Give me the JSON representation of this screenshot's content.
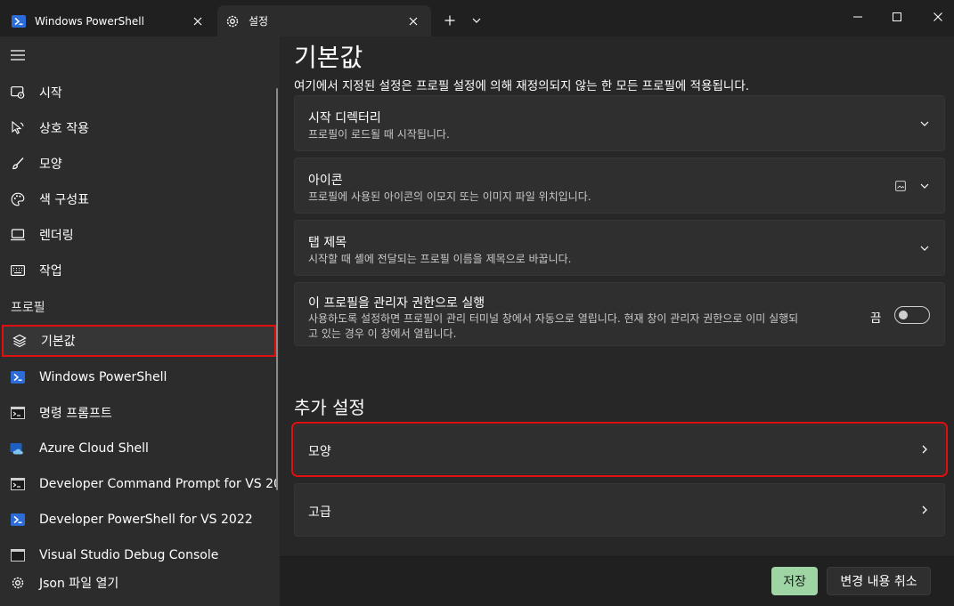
{
  "titlebar": {
    "tabs": [
      {
        "label": "Windows PowerShell",
        "icon": "powershell-icon"
      },
      {
        "label": "설정",
        "icon": "gear-icon"
      }
    ],
    "new_tab_icon": "plus-icon",
    "tab_menu_icon": "chevron-down-icon"
  },
  "sidebar": {
    "items": [
      {
        "label": "시작",
        "icon": "startup-icon"
      },
      {
        "label": "상호 작용",
        "icon": "cursor-icon"
      },
      {
        "label": "모양",
        "icon": "brush-icon"
      },
      {
        "label": "색 구성표",
        "icon": "palette-icon"
      },
      {
        "label": "렌더링",
        "icon": "monitor-icon"
      },
      {
        "label": "작업",
        "icon": "keyboard-icon"
      }
    ],
    "profiles_label": "프로필",
    "profiles": [
      {
        "label": "기본값",
        "icon": "layers-icon"
      },
      {
        "label": "Windows PowerShell",
        "icon": "powershell-icon"
      },
      {
        "label": "명령 프롬프트",
        "icon": "cmd-icon"
      },
      {
        "label": "Azure Cloud Shell",
        "icon": "azure-icon"
      },
      {
        "label": "Developer Command Prompt for VS 20",
        "icon": "cmd-icon"
      },
      {
        "label": "Developer PowerShell for VS 2022",
        "icon": "powershell-icon"
      },
      {
        "label": "Visual Studio Debug Console",
        "icon": "cmd-icon"
      }
    ],
    "open_json": {
      "label": "Json 파일 열기",
      "icon": "gear-icon"
    }
  },
  "main": {
    "title": "기본값",
    "description": "여기에서 지정된 설정은 프로필 설정에 의해 재정의되지 않는 한 모든 프로필에 적용됩니다.",
    "cards": [
      {
        "title": "시작 디렉터리",
        "subtitle": "프로필이 로드될 때 시작됩니다."
      },
      {
        "title": "아이콘",
        "subtitle": "프로필에 사용된 아이콘의 이모지 또는 이미지 파일 위치입니다."
      },
      {
        "title": "탭 제목",
        "subtitle": "시작할 때 셸에 전달되는 프로필 이름을 제목으로 바꿉니다."
      }
    ],
    "elevate": {
      "title": "이 프로필을 관리자 권한으로 실행",
      "subtitle_line1": "사용하도록 설정하면 프로필이 관리 터미널 창에서 자동으로 열립니다. 현재 창이 관리자 권한으로 이미 실행되",
      "subtitle_line2": "고 있는 경우 이 창에서 열립니다.",
      "toggle_label": "끔",
      "toggle_on": false
    },
    "additional_title": "추가 설정",
    "links": [
      {
        "label": "모양"
      },
      {
        "label": "고급"
      }
    ]
  },
  "footer": {
    "save_label": "저장",
    "discard_label": "변경 내용 취소"
  },
  "colors": {
    "accent_save": "#9fd4a4",
    "highlight": "#e01010"
  }
}
